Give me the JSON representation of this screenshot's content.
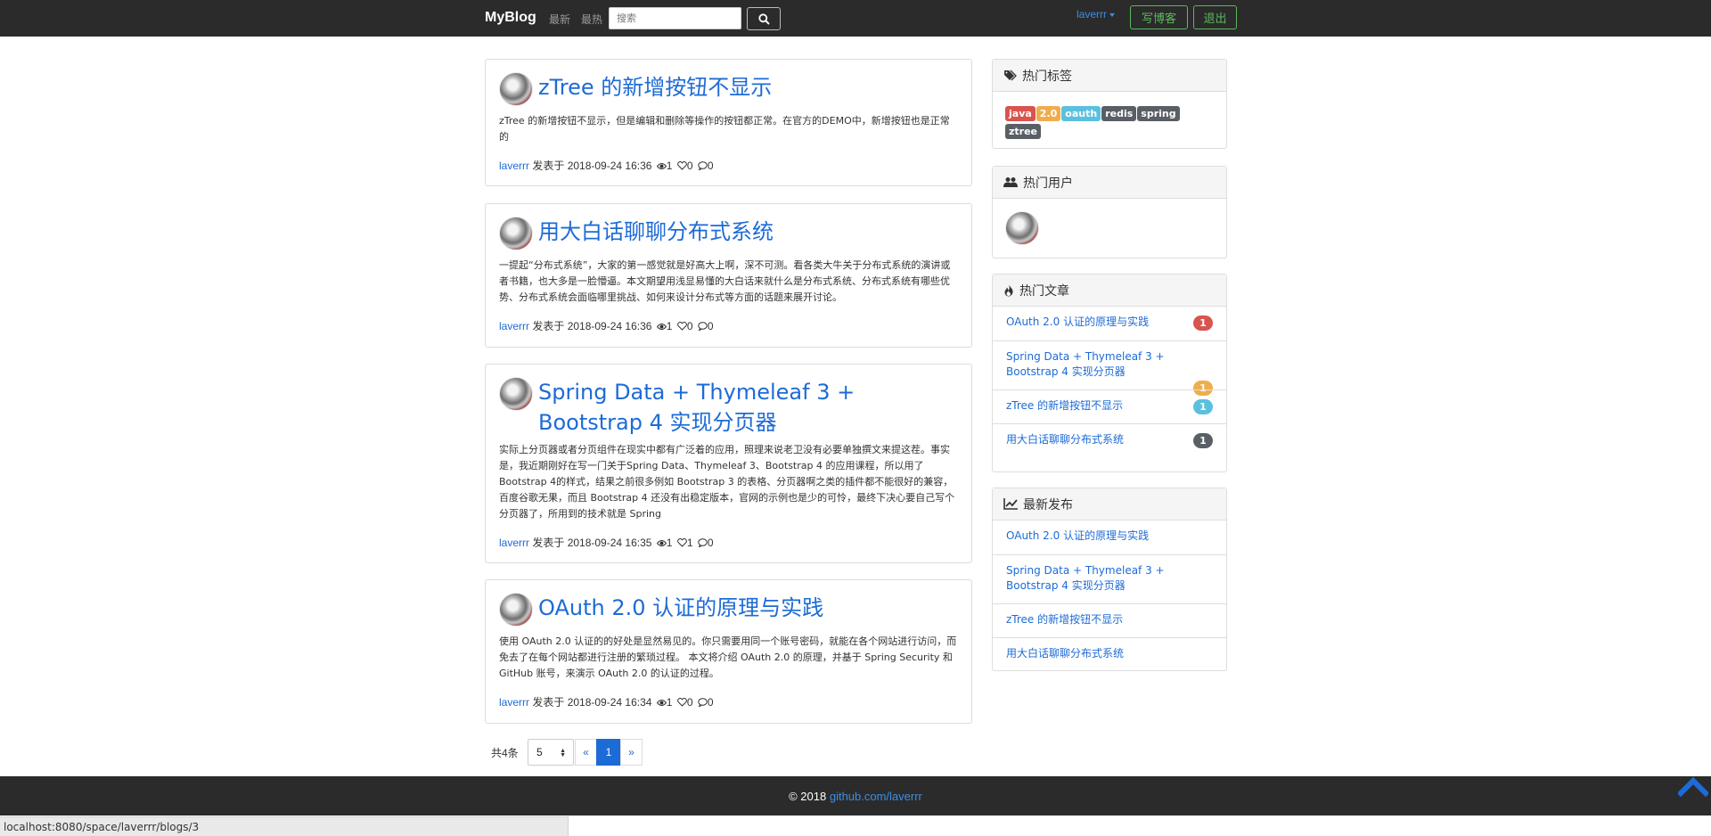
{
  "navbar": {
    "brand": "MyBlog",
    "links": [
      "最新",
      "最热"
    ],
    "search_placeholder": "搜索",
    "username": "laverrr",
    "write_button": "写博客",
    "logout_button": "退出"
  },
  "posts": [
    {
      "title": "zTree 的新增按钮不显示",
      "summary": "zTree 的新增按钮不显示，但是编辑和删除等操作的按钮都正常。在官方的DEMO中，新增按钮也是正常的",
      "author": "laverrr",
      "published": "发表于 2018-09-24 16:36",
      "views": "1",
      "likes": "0",
      "comments": "0"
    },
    {
      "title": "用大白话聊聊分布式系统",
      "summary": "一提起“分布式系统”，大家的第一感觉就是好高大上啊，深不可测。看各类大牛关于分布式系统的演讲或者书籍，也大多是一脸懵逼。本文期望用浅显易懂的大白话来就什么是分布式系统、分布式系统有哪些优势、分布式系统会面临哪里挑战、如何来设计分布式等方面的话题来展开讨论。",
      "author": "laverrr",
      "published": "发表于 2018-09-24 16:36",
      "views": "1",
      "likes": "0",
      "comments": "0"
    },
    {
      "title": "Spring Data + Thymeleaf 3 + Bootstrap 4 实现分页器",
      "summary": "实际上分页器或者分页组件在现实中都有广泛着的应用，照理来说老卫没有必要单独撰文来提这茬。事实是，我近期刚好在写一门关于Spring Data、Thymeleaf 3、Bootstrap 4 的应用课程，所以用了Bootstrap 4的样式，结果之前很多例如 Bootstrap 3 的表格、分页器啊之类的插件都不能很好的兼容，百度谷歌无果，而且 Bootstrap 4 还没有出稳定版本，官网的示例也是少的可怜，最终下决心要自己写个分页器了，所用到的技术就是 Spring",
      "author": "laverrr",
      "published": "发表于 2018-09-24 16:35",
      "views": "1",
      "likes": "1",
      "comments": "0"
    },
    {
      "title": "OAuth 2.0 认证的原理与实践",
      "summary": "使用 OAuth 2.0 认证的的好处是显然易见的。你只需要用同一个账号密码，就能在各个网站进行访问，而免去了在每个网站都进行注册的繁琐过程。 本文将介绍 OAuth 2.0 的原理，并基于 Spring Security 和 GitHub 账号，来演示 OAuth 2.0 的认证的过程。",
      "author": "laverrr",
      "published": "发表于 2018-09-24 16:34",
      "views": "1",
      "likes": "0",
      "comments": "0"
    }
  ],
  "pagination": {
    "total": "共4条",
    "page_size": "5",
    "prev": "«",
    "current": "1",
    "next": "»"
  },
  "sidebar": {
    "hot_tags_title": "热门标签",
    "tags": [
      {
        "label": "java",
        "color": "#d9534f"
      },
      {
        "label": "2.0",
        "color": "#f0ad4e"
      },
      {
        "label": "oauth",
        "color": "#5bc0de"
      },
      {
        "label": "redis",
        "color": "#5a5f66"
      },
      {
        "label": "spring",
        "color": "#5a5f66"
      },
      {
        "label": "ztree",
        "color": "#5a5f66"
      }
    ],
    "hot_users_title": "热门用户",
    "hot_posts_title": "热门文章",
    "hot_posts": [
      {
        "title": "OAuth 2.0 认证的原理与实践",
        "count": "1",
        "color": "#d9534f"
      },
      {
        "title": "Spring Data + Thymeleaf 3 + Bootstrap 4 实现分页器",
        "count": "1",
        "color": "#f0ad4e"
      },
      {
        "title": "zTree 的新增按钮不显示",
        "count": "1",
        "color": "#5bc0de"
      },
      {
        "title": "用大白话聊聊分布式系统",
        "count": "1",
        "color": "#5a5f66"
      }
    ],
    "latest_title": "最新发布",
    "latest": [
      "OAuth 2.0 认证的原理与实践",
      "Spring Data + Thymeleaf 3 + Bootstrap 4 实现分页器",
      "zTree 的新增按钮不显示",
      "用大白话聊聊分布式系统"
    ]
  },
  "footer": {
    "copyright": "© 2018",
    "link": "github.com/laverrr"
  },
  "status_bar": "localhost:8080/space/laverrr/blogs/3",
  "colors": {
    "navbar_bg": "#2b2b2b",
    "link": "#1d6bd6",
    "accent_green": "#5cb85c"
  }
}
